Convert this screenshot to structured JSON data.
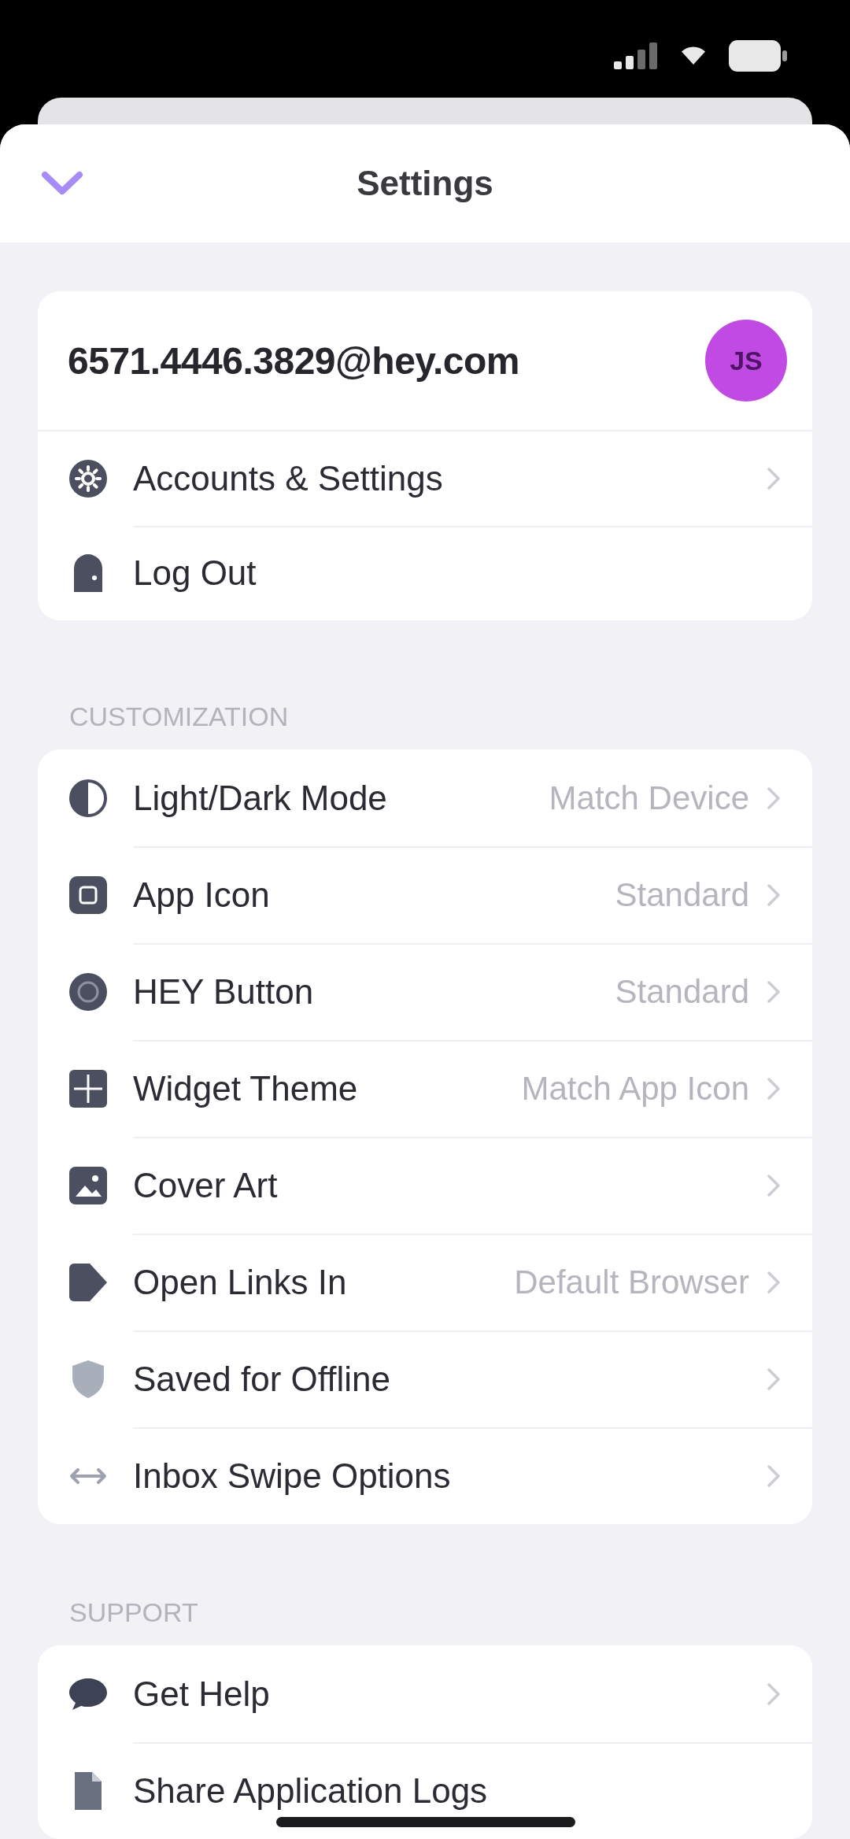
{
  "header": {
    "title": "Settings"
  },
  "account": {
    "email": "6571.4446.3829@hey.com",
    "avatar_initials": "JS",
    "rows": [
      {
        "label": "Accounts & Settings",
        "kind": "nav"
      },
      {
        "label": "Log Out",
        "kind": "action"
      }
    ]
  },
  "sections": [
    {
      "heading": "CUSTOMIZATION",
      "rows": [
        {
          "label": "Light/Dark Mode",
          "value": "Match Device",
          "kind": "nav"
        },
        {
          "label": "App Icon",
          "value": "Standard",
          "kind": "nav"
        },
        {
          "label": "HEY Button",
          "value": "Standard",
          "kind": "nav"
        },
        {
          "label": "Widget Theme",
          "value": "Match App Icon",
          "kind": "nav"
        },
        {
          "label": "Cover Art",
          "kind": "nav"
        },
        {
          "label": "Open Links In",
          "value": "Default Browser",
          "kind": "nav"
        },
        {
          "label": "Saved for Offline",
          "kind": "nav"
        },
        {
          "label": "Inbox Swipe Options",
          "kind": "nav"
        }
      ]
    },
    {
      "heading": "SUPPORT",
      "rows": [
        {
          "label": "Get Help",
          "kind": "nav"
        },
        {
          "label": "Share Application Logs",
          "kind": "action"
        }
      ]
    }
  ]
}
